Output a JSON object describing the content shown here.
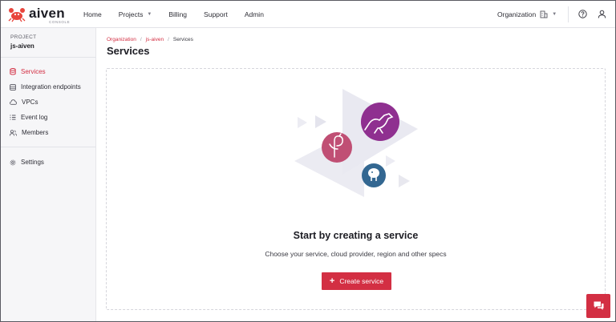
{
  "topbar": {
    "logo_text": "aiven",
    "logo_sub": "CONSOLE",
    "nav": [
      {
        "label": "Home"
      },
      {
        "label": "Projects"
      },
      {
        "label": "Billing"
      },
      {
        "label": "Support"
      },
      {
        "label": "Admin"
      }
    ],
    "org_label": "Organization"
  },
  "sidebar": {
    "project_label": "PROJECT",
    "project_name": "js-aiven",
    "items": [
      {
        "label": "Services",
        "icon": "database-icon",
        "active": true
      },
      {
        "label": "Integration endpoints",
        "icon": "stack-icon"
      },
      {
        "label": "VPCs",
        "icon": "cloud-icon"
      },
      {
        "label": "Event log",
        "icon": "list-icon"
      },
      {
        "label": "Members",
        "icon": "people-icon"
      }
    ],
    "settings_label": "Settings"
  },
  "main": {
    "breadcrumb": [
      "Organization",
      "js-aiven",
      "Services"
    ],
    "title": "Services",
    "empty_title": "Start by creating a service",
    "empty_subtitle": "Choose your service, cloud provider, region and other specs",
    "create_label": "Create service"
  },
  "colors": {
    "accent": "#d32f43",
    "kafka": "#a3338f",
    "flamingo": "#c04f74",
    "postgres": "#336791"
  }
}
